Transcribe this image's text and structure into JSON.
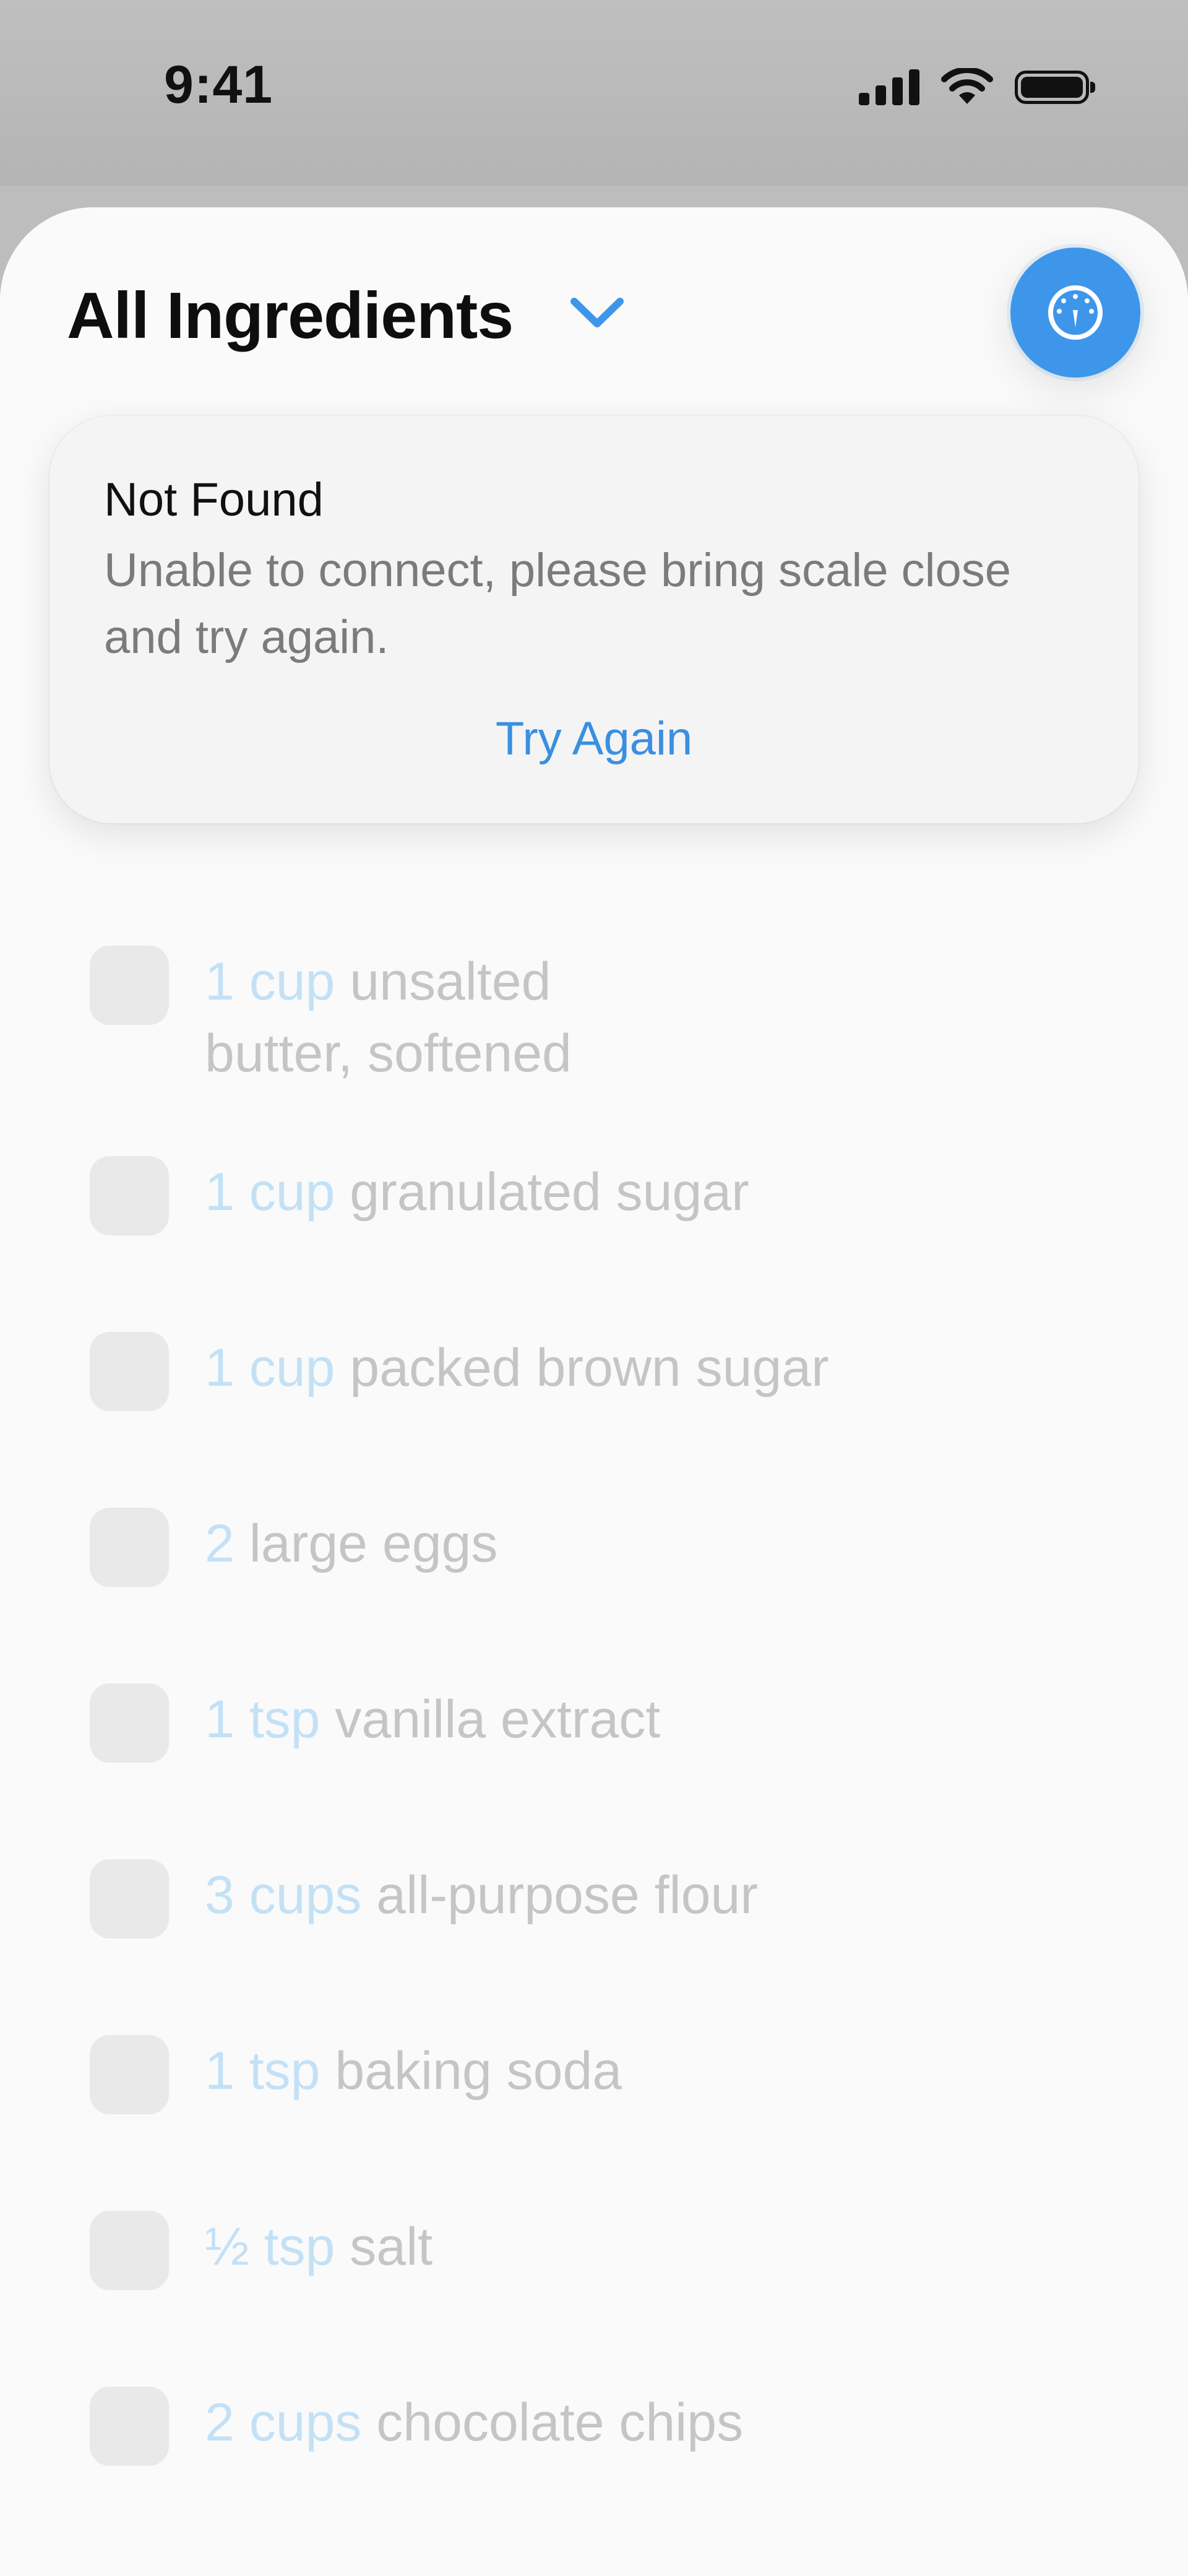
{
  "status_bar": {
    "time": "9:41",
    "icons": [
      "cellular-signal-icon",
      "wifi-icon",
      "battery-icon"
    ]
  },
  "header": {
    "title": "All Ingredients",
    "dropdown_icon": "chevron-down-icon",
    "scale_button_icon": "scale-gauge-icon"
  },
  "alert": {
    "title": "Not Found",
    "message": "Unable to connect, please bring scale close and try again.",
    "action_label": "Try Again"
  },
  "ingredients": [
    {
      "qty": "1 cup",
      "name": "unsalted butter, softened"
    },
    {
      "qty": "1 cup",
      "name": "granulated sugar"
    },
    {
      "qty": "1 cup",
      "name": "packed brown sugar"
    },
    {
      "qty": "2",
      "name": "large eggs"
    },
    {
      "qty": "1 tsp",
      "name": "vanilla extract"
    },
    {
      "qty": "3 cups",
      "name": "all-purpose flour"
    },
    {
      "qty": "1 tsp",
      "name": "baking soda"
    },
    {
      "qty": "½ tsp",
      "name": "salt"
    },
    {
      "qty": "2 cups",
      "name": "chocolate chips"
    }
  ],
  "colors": {
    "accent": "#3d96ea",
    "link": "#3a8fe0",
    "quantity_faded": "#c3e1f6",
    "text_faded": "#c5c5c5",
    "checkbox": "#e9e9e9"
  }
}
